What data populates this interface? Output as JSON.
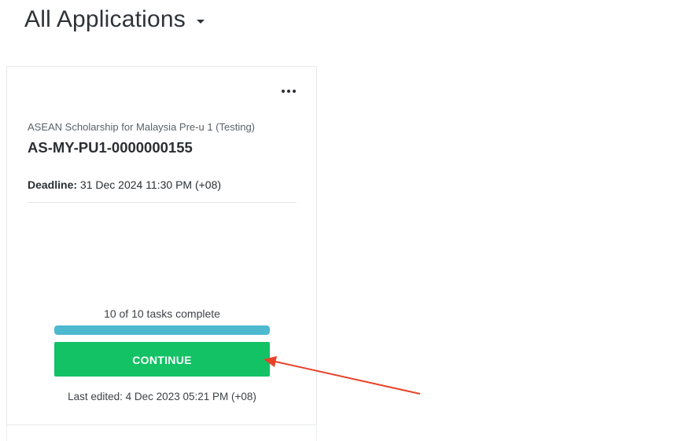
{
  "header": {
    "title": "All Applications"
  },
  "card": {
    "program_name": "ASEAN Scholarship for Malaysia Pre-u 1 (Testing)",
    "application_id": "AS-MY-PU1-0000000155",
    "deadline_label": "Deadline:",
    "deadline_value": "31 Dec 2024 11:30 PM (+08)",
    "tasks_text": "10 of 10 tasks complete",
    "tasks_completed": 10,
    "tasks_total": 10,
    "continue_label": "CONTINUE",
    "last_edited": "Last edited: 4 Dec 2023 05:21 PM (+08)"
  },
  "colors": {
    "progress_fill": "#4cb9cf",
    "continue_button": "#12c264",
    "annotation_arrow": "#e8432a"
  },
  "icons": {
    "header_dropdown": "caret-down-icon",
    "card_menu": "more-horizontal-icon",
    "annotation": "red-arrow"
  }
}
